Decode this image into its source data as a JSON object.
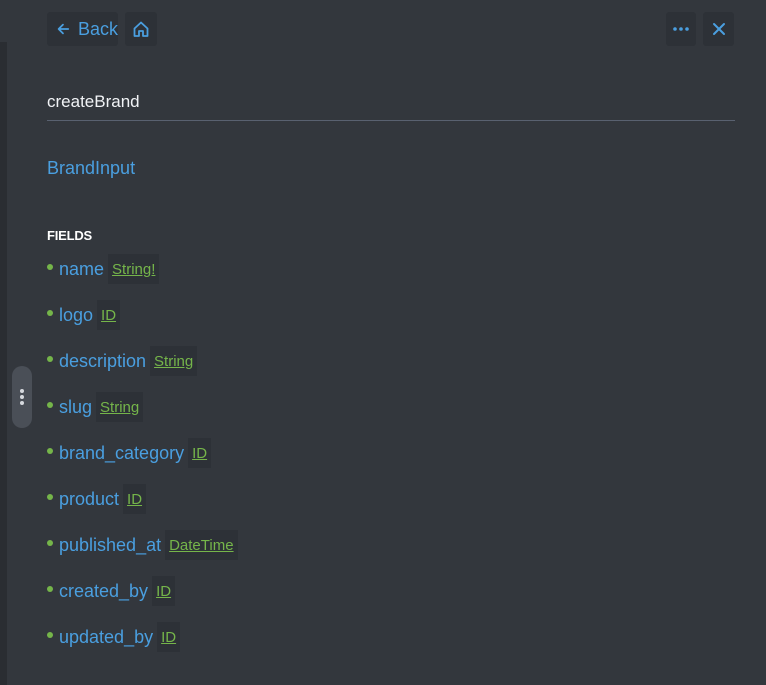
{
  "header": {
    "back_label": "Back",
    "icons": {
      "back": "arrow-left-icon",
      "home": "home-icon",
      "more": "more-horizontal-icon",
      "close": "close-icon"
    }
  },
  "doc": {
    "title": "createBrand",
    "input_type": "BrandInput",
    "fields_label": "FIELDS",
    "fields": [
      {
        "name": "name",
        "type": "String!"
      },
      {
        "name": "logo",
        "type": "ID"
      },
      {
        "name": "description",
        "type": "String"
      },
      {
        "name": "slug",
        "type": "String"
      },
      {
        "name": "brand_category",
        "type": "ID"
      },
      {
        "name": "product",
        "type": "ID"
      },
      {
        "name": "published_at",
        "type": "DateTime"
      },
      {
        "name": "created_by",
        "type": "ID"
      },
      {
        "name": "updated_by",
        "type": "ID"
      }
    ]
  },
  "colors": {
    "background": "#33373d",
    "link": "#4a9fe0",
    "type": "#75b54a",
    "button_bg": "#2d3137"
  }
}
